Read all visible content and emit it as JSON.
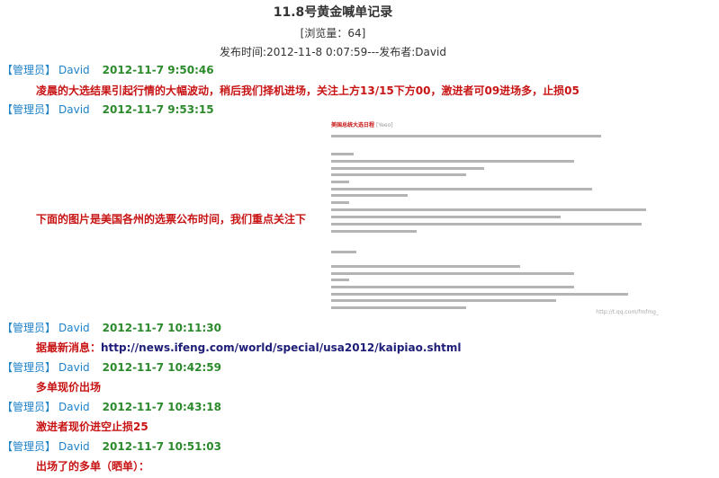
{
  "page": {
    "title": "11.8号黄金喊单记录",
    "views": "[浏览量：64]",
    "publish": "发布时间:2012-11-8 0:07:59---发布者:David"
  },
  "posts": [
    {
      "role": "【管理员】",
      "author": "David",
      "time": "2012-11-7 9:50:46",
      "message": "凌晨的大选结果引起行情的大幅波动，稍后我们择机进场，关注上方13/15下方00，激进者可09进场多，止损05"
    },
    {
      "role": "【管理员】",
      "author": "David",
      "time": "2012-11-7 9:53:15",
      "message": "下面的图片是美国各州的选票公布时间，我们重点关注下"
    },
    {
      "role": "【管理员】",
      "author": "David",
      "time": "2012-11-7 10:11:30",
      "message_prefix": "据最新消息：",
      "link": "http://news.ifeng.com/world/special/usa2012/kaipiao.shtml"
    },
    {
      "role": "【管理员】",
      "author": "David",
      "time": "2012-11-7 10:42:59",
      "message": "多单现价出场"
    },
    {
      "role": "【管理员】",
      "author": "David",
      "time": "2012-11-7 10:43:18",
      "message": "激进者现价进空止损25"
    },
    {
      "role": "【管理员】",
      "author": "David",
      "time": "2012-11-7 10:51:03",
      "message": "出场了的多单（晒单）："
    }
  ],
  "doc_image": {
    "title": "美国总统大选日程",
    "source": "[Yeeo]",
    "watermark": "http://t.qq.com/fmfmg_"
  }
}
